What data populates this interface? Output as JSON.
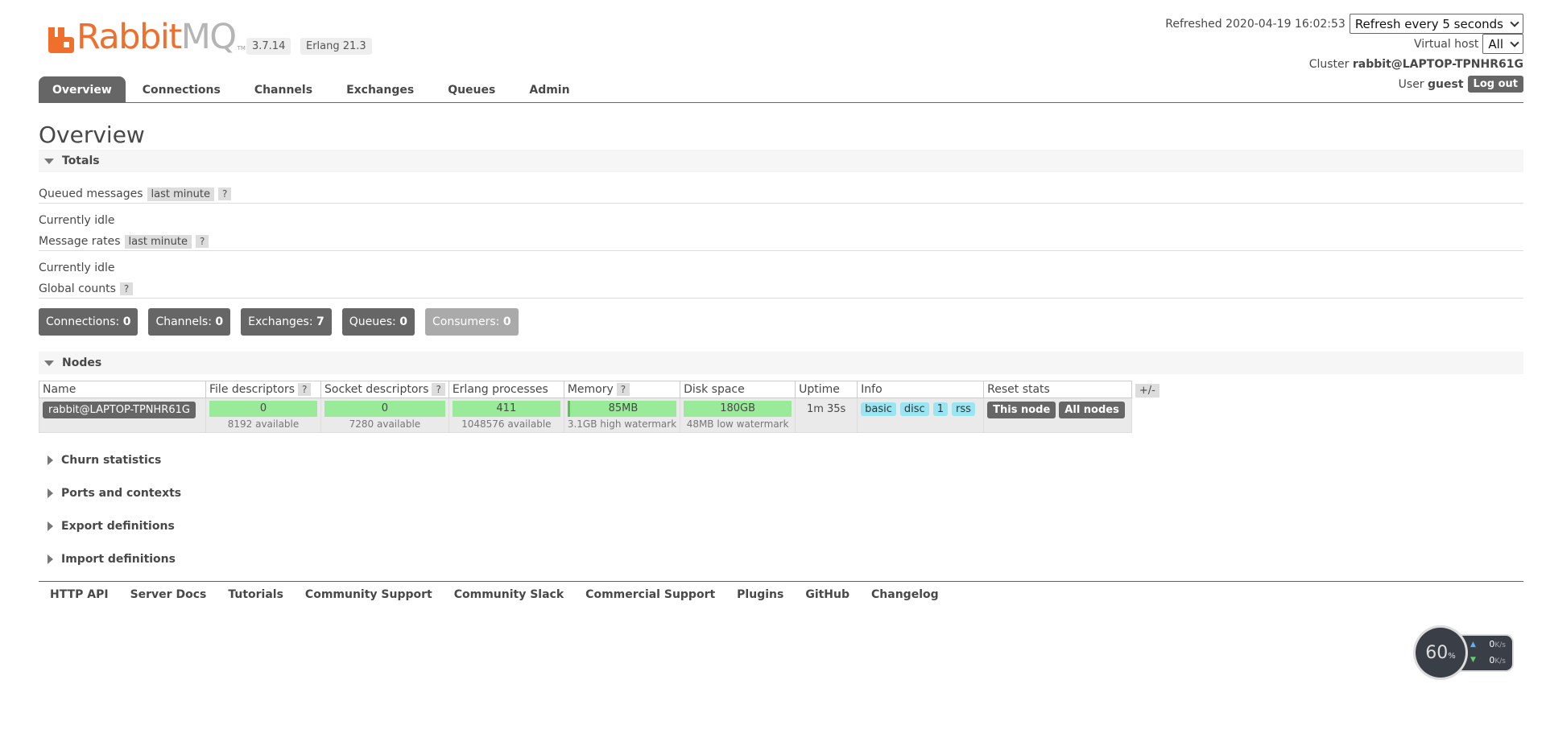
{
  "header": {
    "logo": {
      "rabbit": "Rabbit",
      "mq": "MQ",
      "tm": "TM"
    },
    "version": "3.7.14",
    "erlang": "Erlang 21.3",
    "refreshed_label": "Refreshed",
    "refreshed_time": "2020-04-19 16:02:53",
    "refresh_select": "Refresh every 5 seconds",
    "vhost_label": "Virtual host",
    "vhost_select": "All",
    "cluster_label": "Cluster",
    "cluster_name": "rabbit@LAPTOP-TPNHR61G",
    "user_label": "User",
    "user_name": "guest",
    "logout": "Log out"
  },
  "tabs": [
    "Overview",
    "Connections",
    "Channels",
    "Exchanges",
    "Queues",
    "Admin"
  ],
  "page_title": "Overview",
  "totals": {
    "title": "Totals",
    "queued_label": "Queued messages",
    "queued_tag": "last minute",
    "help": "?",
    "queued_status": "Currently idle",
    "rates_label": "Message rates",
    "rates_tag": "last minute",
    "rates_status": "Currently idle",
    "global_label": "Global counts",
    "counts": [
      {
        "label": "Connections:",
        "value": "0"
      },
      {
        "label": "Channels:",
        "value": "0"
      },
      {
        "label": "Exchanges:",
        "value": "7"
      },
      {
        "label": "Queues:",
        "value": "0"
      },
      {
        "label": "Consumers:",
        "value": "0"
      }
    ]
  },
  "nodes": {
    "title": "Nodes",
    "columns": [
      "Name",
      "File descriptors",
      "Socket descriptors",
      "Erlang processes",
      "Memory",
      "Disk space",
      "Uptime",
      "Info",
      "Reset stats"
    ],
    "toggle": "+/-",
    "row": {
      "name": "rabbit@LAPTOP-TPNHR61G",
      "fd": "0",
      "fd_avail": "8192 available",
      "sd": "0",
      "sd_avail": "7280 available",
      "ep": "411",
      "ep_avail": "1048576 available",
      "mem": "85MB",
      "mem_wm": "3.1GB high watermark",
      "disk": "180GB",
      "disk_wm": "48MB low watermark",
      "uptime": "1m 35s",
      "info": [
        "basic",
        "disc",
        "1",
        "rss"
      ],
      "reset_this": "This node",
      "reset_all": "All nodes"
    }
  },
  "sections": [
    "Churn statistics",
    "Ports and contexts",
    "Export definitions",
    "Import definitions"
  ],
  "footer": [
    "HTTP API",
    "Server Docs",
    "Tutorials",
    "Community Support",
    "Community Slack",
    "Commercial Support",
    "Plugins",
    "GitHub",
    "Changelog"
  ],
  "speed_widget": {
    "percent": "60",
    "percent_unit": "%",
    "up": "0",
    "down": "0",
    "unit": "K/s"
  },
  "colors": {
    "brand": "#f06f2c",
    "tab_active": "#666666",
    "bar_green": "#99eb99",
    "info_blue": "#99e6f2"
  }
}
